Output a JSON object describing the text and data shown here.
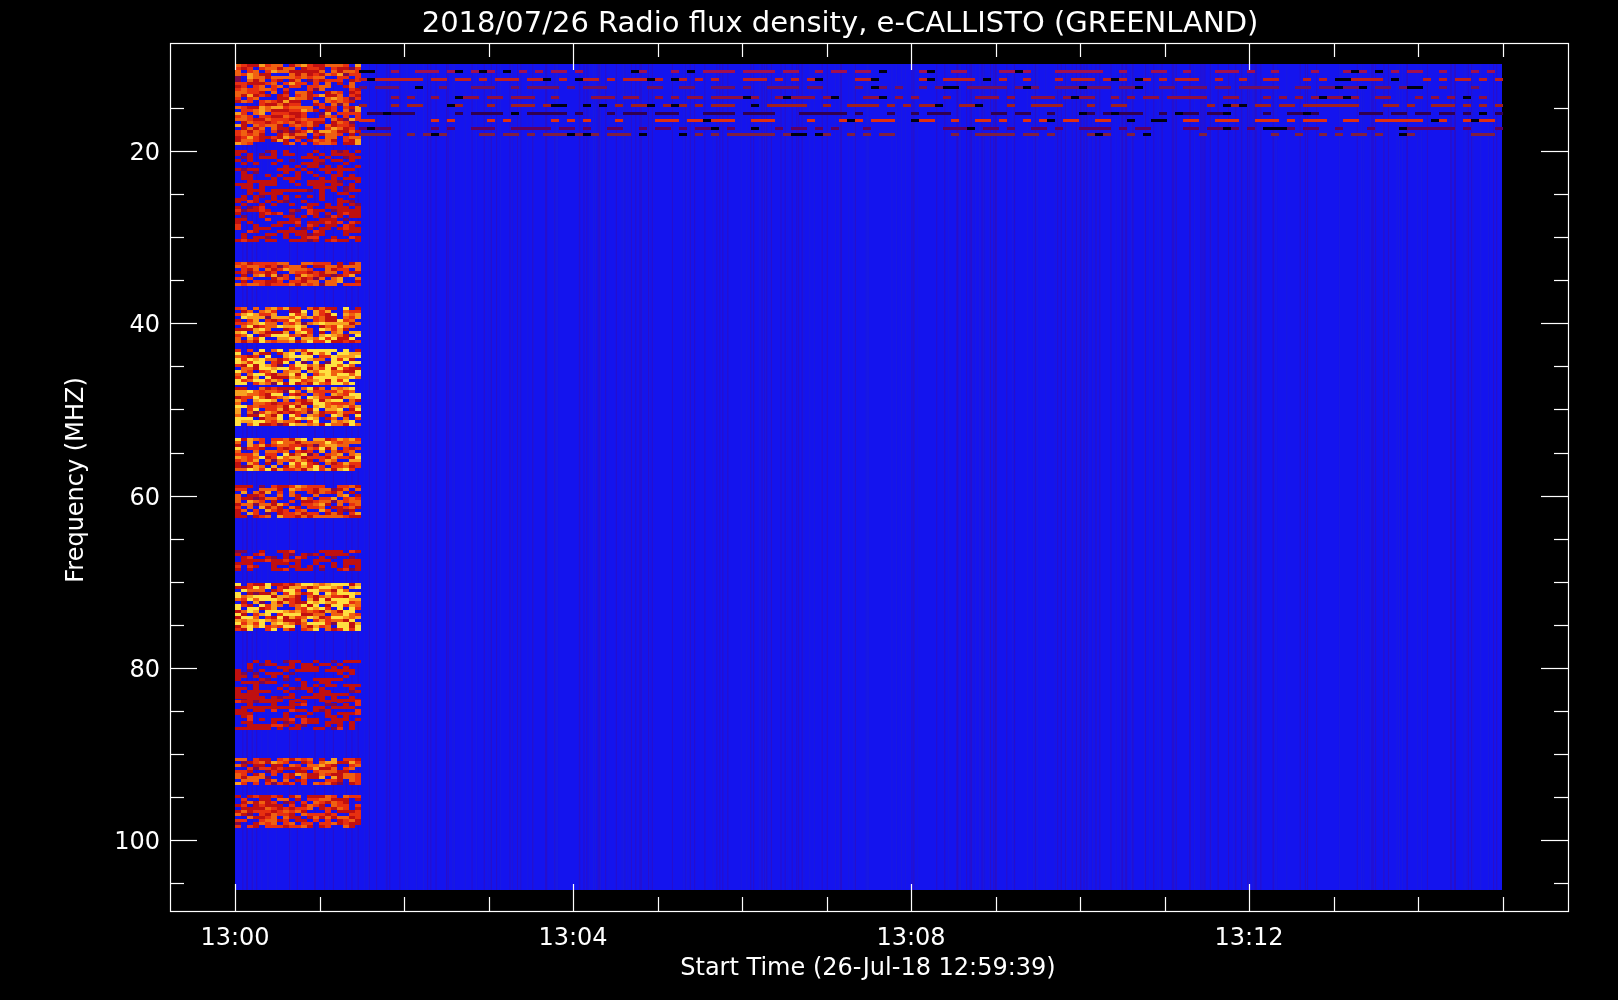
{
  "title": "2018/07/26  Radio flux density, e-CALLISTO (GREENLAND)",
  "y_axis": {
    "label": "Frequency (MHZ)",
    "ticks": [
      "20",
      "40",
      "60",
      "80",
      "100"
    ]
  },
  "x_axis": {
    "label": "Start Time (26-Jul-18 12:59:39)",
    "ticks": [
      "13:00",
      "13:04",
      "13:08",
      "13:12"
    ]
  }
}
